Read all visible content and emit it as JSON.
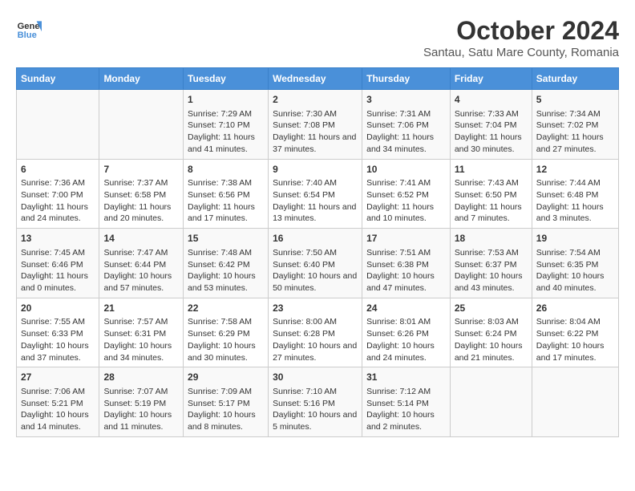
{
  "header": {
    "logo_line1": "General",
    "logo_line2": "Blue",
    "title": "October 2024",
    "subtitle": "Santau, Satu Mare County, Romania"
  },
  "weekdays": [
    "Sunday",
    "Monday",
    "Tuesday",
    "Wednesday",
    "Thursday",
    "Friday",
    "Saturday"
  ],
  "weeks": [
    [
      {
        "num": "",
        "info": ""
      },
      {
        "num": "",
        "info": ""
      },
      {
        "num": "1",
        "info": "Sunrise: 7:29 AM\nSunset: 7:10 PM\nDaylight: 11 hours and 41 minutes."
      },
      {
        "num": "2",
        "info": "Sunrise: 7:30 AM\nSunset: 7:08 PM\nDaylight: 11 hours and 37 minutes."
      },
      {
        "num": "3",
        "info": "Sunrise: 7:31 AM\nSunset: 7:06 PM\nDaylight: 11 hours and 34 minutes."
      },
      {
        "num": "4",
        "info": "Sunrise: 7:33 AM\nSunset: 7:04 PM\nDaylight: 11 hours and 30 minutes."
      },
      {
        "num": "5",
        "info": "Sunrise: 7:34 AM\nSunset: 7:02 PM\nDaylight: 11 hours and 27 minutes."
      }
    ],
    [
      {
        "num": "6",
        "info": "Sunrise: 7:36 AM\nSunset: 7:00 PM\nDaylight: 11 hours and 24 minutes."
      },
      {
        "num": "7",
        "info": "Sunrise: 7:37 AM\nSunset: 6:58 PM\nDaylight: 11 hours and 20 minutes."
      },
      {
        "num": "8",
        "info": "Sunrise: 7:38 AM\nSunset: 6:56 PM\nDaylight: 11 hours and 17 minutes."
      },
      {
        "num": "9",
        "info": "Sunrise: 7:40 AM\nSunset: 6:54 PM\nDaylight: 11 hours and 13 minutes."
      },
      {
        "num": "10",
        "info": "Sunrise: 7:41 AM\nSunset: 6:52 PM\nDaylight: 11 hours and 10 minutes."
      },
      {
        "num": "11",
        "info": "Sunrise: 7:43 AM\nSunset: 6:50 PM\nDaylight: 11 hours and 7 minutes."
      },
      {
        "num": "12",
        "info": "Sunrise: 7:44 AM\nSunset: 6:48 PM\nDaylight: 11 hours and 3 minutes."
      }
    ],
    [
      {
        "num": "13",
        "info": "Sunrise: 7:45 AM\nSunset: 6:46 PM\nDaylight: 11 hours and 0 minutes."
      },
      {
        "num": "14",
        "info": "Sunrise: 7:47 AM\nSunset: 6:44 PM\nDaylight: 10 hours and 57 minutes."
      },
      {
        "num": "15",
        "info": "Sunrise: 7:48 AM\nSunset: 6:42 PM\nDaylight: 10 hours and 53 minutes."
      },
      {
        "num": "16",
        "info": "Sunrise: 7:50 AM\nSunset: 6:40 PM\nDaylight: 10 hours and 50 minutes."
      },
      {
        "num": "17",
        "info": "Sunrise: 7:51 AM\nSunset: 6:38 PM\nDaylight: 10 hours and 47 minutes."
      },
      {
        "num": "18",
        "info": "Sunrise: 7:53 AM\nSunset: 6:37 PM\nDaylight: 10 hours and 43 minutes."
      },
      {
        "num": "19",
        "info": "Sunrise: 7:54 AM\nSunset: 6:35 PM\nDaylight: 10 hours and 40 minutes."
      }
    ],
    [
      {
        "num": "20",
        "info": "Sunrise: 7:55 AM\nSunset: 6:33 PM\nDaylight: 10 hours and 37 minutes."
      },
      {
        "num": "21",
        "info": "Sunrise: 7:57 AM\nSunset: 6:31 PM\nDaylight: 10 hours and 34 minutes."
      },
      {
        "num": "22",
        "info": "Sunrise: 7:58 AM\nSunset: 6:29 PM\nDaylight: 10 hours and 30 minutes."
      },
      {
        "num": "23",
        "info": "Sunrise: 8:00 AM\nSunset: 6:28 PM\nDaylight: 10 hours and 27 minutes."
      },
      {
        "num": "24",
        "info": "Sunrise: 8:01 AM\nSunset: 6:26 PM\nDaylight: 10 hours and 24 minutes."
      },
      {
        "num": "25",
        "info": "Sunrise: 8:03 AM\nSunset: 6:24 PM\nDaylight: 10 hours and 21 minutes."
      },
      {
        "num": "26",
        "info": "Sunrise: 8:04 AM\nSunset: 6:22 PM\nDaylight: 10 hours and 17 minutes."
      }
    ],
    [
      {
        "num": "27",
        "info": "Sunrise: 7:06 AM\nSunset: 5:21 PM\nDaylight: 10 hours and 14 minutes."
      },
      {
        "num": "28",
        "info": "Sunrise: 7:07 AM\nSunset: 5:19 PM\nDaylight: 10 hours and 11 minutes."
      },
      {
        "num": "29",
        "info": "Sunrise: 7:09 AM\nSunset: 5:17 PM\nDaylight: 10 hours and 8 minutes."
      },
      {
        "num": "30",
        "info": "Sunrise: 7:10 AM\nSunset: 5:16 PM\nDaylight: 10 hours and 5 minutes."
      },
      {
        "num": "31",
        "info": "Sunrise: 7:12 AM\nSunset: 5:14 PM\nDaylight: 10 hours and 2 minutes."
      },
      {
        "num": "",
        "info": ""
      },
      {
        "num": "",
        "info": ""
      }
    ]
  ]
}
